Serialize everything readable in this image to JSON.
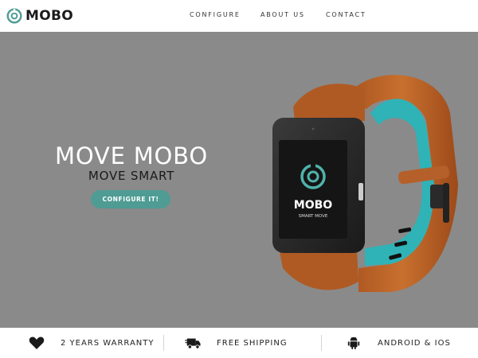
{
  "brand": {
    "name": "MOBO",
    "accent": "#4e9c94"
  },
  "nav": {
    "links": [
      "CONFIGURE",
      "ABOUT US",
      "CONTACT"
    ]
  },
  "hero": {
    "title": "MOVE MOBO",
    "subtitle": "MOVE SMART",
    "cta_label": "CONFIGURE IT!",
    "background": "#8a8a8a",
    "watch": {
      "screen_brand": "MOBO",
      "screen_tagline": "SMART MOVE"
    }
  },
  "features": [
    {
      "icon": "heart-icon",
      "label": "2 YEARS WARRANTY"
    },
    {
      "icon": "truck-icon",
      "label": "FREE SHIPPING"
    },
    {
      "icon": "android-icon",
      "label": "ANDROID & IOS"
    }
  ]
}
